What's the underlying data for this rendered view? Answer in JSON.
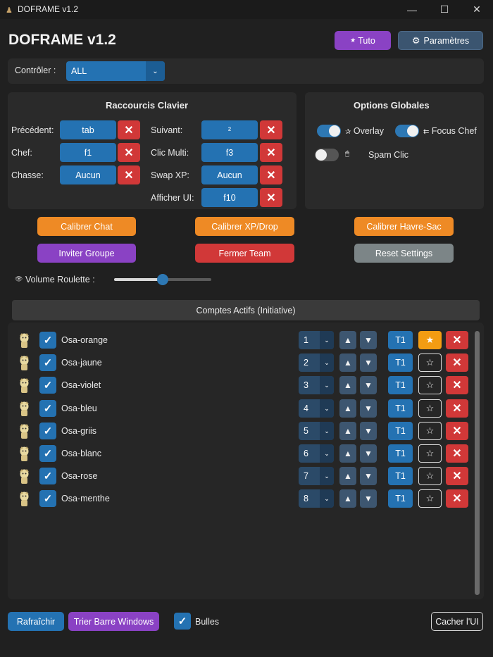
{
  "window": {
    "title": "DOFRAME v1.2",
    "minimize": "—",
    "maximize": "☐",
    "close": "✕"
  },
  "header": {
    "app_title": "DOFRAME v1.2",
    "tuto_label": "Tuto",
    "tuto_icon": "★",
    "settings_label": "Paramètres",
    "settings_icon": "⚙"
  },
  "controller": {
    "label": "Contrôler :",
    "value": "ALL",
    "arrow": "⌄"
  },
  "shortcuts": {
    "title": "Raccourcis Clavier",
    "items": [
      {
        "label": "Précédent:",
        "key": "tab"
      },
      {
        "label": "Chef:",
        "key": "f1"
      },
      {
        "label": "Chasse:",
        "key": "Aucun"
      },
      {
        "label": "Suivant:",
        "key": "²"
      },
      {
        "label": "Clic Multi:",
        "key": "f3"
      },
      {
        "label": "Swap XP:",
        "key": "Aucun"
      },
      {
        "label": "Afficher UI:",
        "key": "f10"
      }
    ],
    "clear_glyph": "✕"
  },
  "options": {
    "title": "Options Globales",
    "overlay": {
      "label": "Overlay",
      "icon": "✰",
      "enabled": true
    },
    "focus_chef": {
      "label": "Focus Chef",
      "icon": "⇇",
      "enabled": true
    },
    "spam_clic": {
      "label": "Spam Clic",
      "icon": "🖱",
      "enabled": false
    }
  },
  "actions": {
    "calibrer_chat": "Calibrer Chat",
    "calibrer_xp": "Calibrer XP/Drop",
    "calibrer_havre": "Calibrer Havre-Sac",
    "inviter_groupe": "Inviter Groupe",
    "fermer_team": "Fermer Team",
    "reset_settings": "Reset Settings"
  },
  "volume": {
    "label": "Volume Roulette :",
    "icon": "👁",
    "level": 0.5
  },
  "accounts": {
    "header": "Comptes Actifs (Initiative)",
    "up": "▲",
    "down": "▼",
    "check": "✓",
    "star": "☆",
    "star_active": "★",
    "remove": "✕",
    "dropdown": "⌄",
    "rows": [
      {
        "name": "Osa-orange",
        "initiative": "1",
        "team": "T1",
        "checked": true,
        "leader": true
      },
      {
        "name": "Osa-jaune",
        "initiative": "2",
        "team": "T1",
        "checked": true,
        "leader": false
      },
      {
        "name": "Osa-violet",
        "initiative": "3",
        "team": "T1",
        "checked": true,
        "leader": false
      },
      {
        "name": "Osa-bleu",
        "initiative": "4",
        "team": "T1",
        "checked": true,
        "leader": false
      },
      {
        "name": "Osa-griis",
        "initiative": "5",
        "team": "T1",
        "checked": true,
        "leader": false
      },
      {
        "name": "Osa-blanc",
        "initiative": "6",
        "team": "T1",
        "checked": true,
        "leader": false
      },
      {
        "name": "Osa-rose",
        "initiative": "7",
        "team": "T1",
        "checked": true,
        "leader": false
      },
      {
        "name": "Osa-menthe",
        "initiative": "8",
        "team": "T1",
        "checked": true,
        "leader": false
      }
    ]
  },
  "footer": {
    "refresh": "Rafraîchir",
    "sort_taskbar": "Trier Barre Windows",
    "bubbles_label": "Bulles",
    "bubbles_checked": true,
    "hide_ui": "Cacher l'UI"
  },
  "colors": {
    "accent_blue": "#2472b2",
    "purple": "#8a42c4",
    "orange": "#ee8a25",
    "red": "#d13838",
    "grey": "#7c8587",
    "gold": "#f39c12"
  }
}
